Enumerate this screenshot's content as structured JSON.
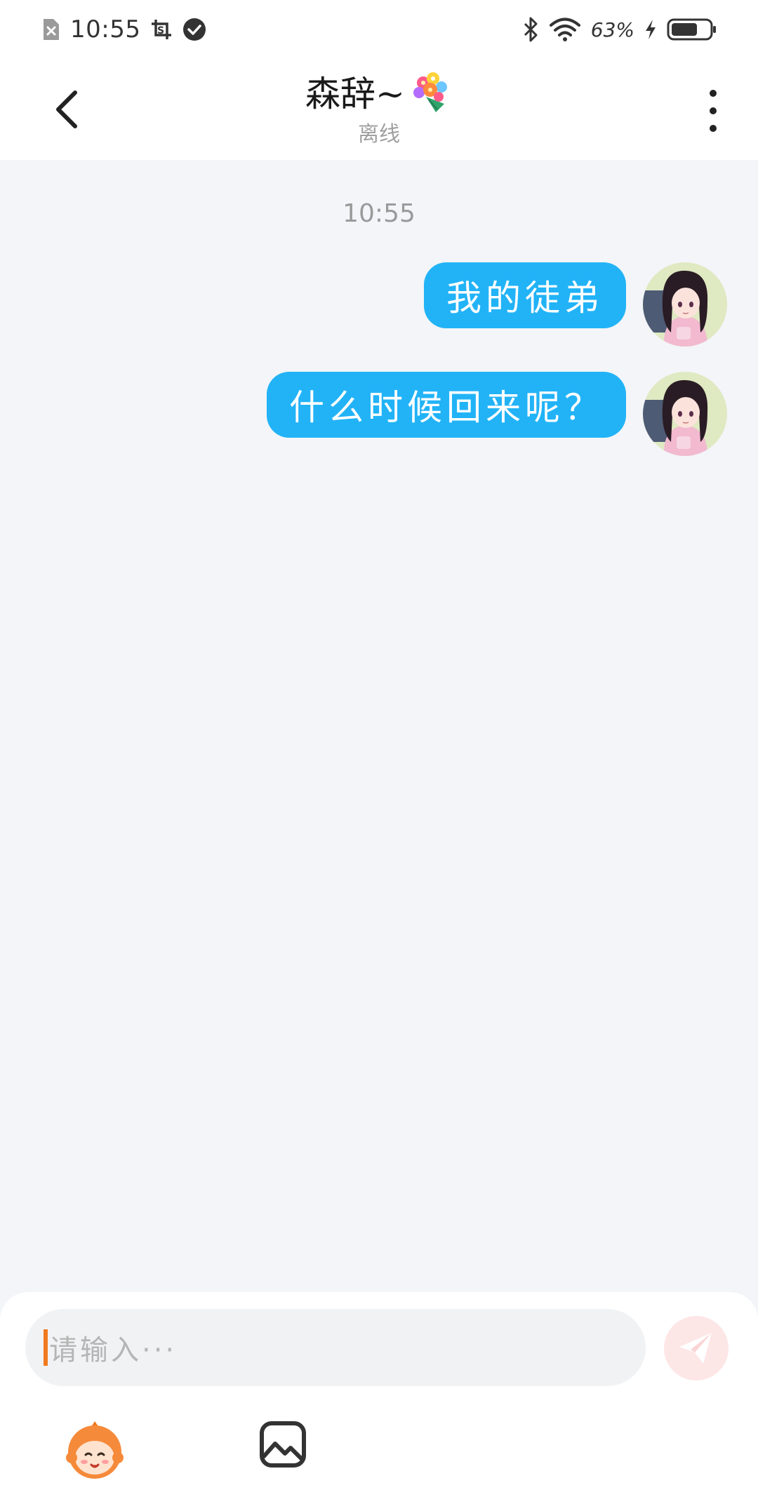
{
  "status_bar": {
    "time": "10:55",
    "battery_percent": "63%"
  },
  "header": {
    "title": "森辞~",
    "subtitle": "离线"
  },
  "chat": {
    "timestamp": "10:55",
    "messages": [
      {
        "text": "我的徒弟",
        "sender": "self"
      },
      {
        "text": "什么时候回来呢？",
        "sender": "self"
      }
    ]
  },
  "composer": {
    "placeholder": "请输入···"
  },
  "colors": {
    "bubble": "#22b3f7",
    "caret": "#f07a1e",
    "send_button_bg": "#fde6e6"
  },
  "icons": {
    "status_left": [
      "sim-off-icon",
      "screenshot-crop-icon",
      "check-circle-icon"
    ],
    "status_right": [
      "bluetooth-icon",
      "wifi-icon",
      "charging-icon",
      "battery-icon"
    ],
    "header": [
      "back-chevron-icon",
      "bouquet-emoji-icon",
      "more-vertical-icon"
    ],
    "composer": [
      "send-paper-plane-icon",
      "emoji-face-icon",
      "image-gallery-icon"
    ]
  }
}
